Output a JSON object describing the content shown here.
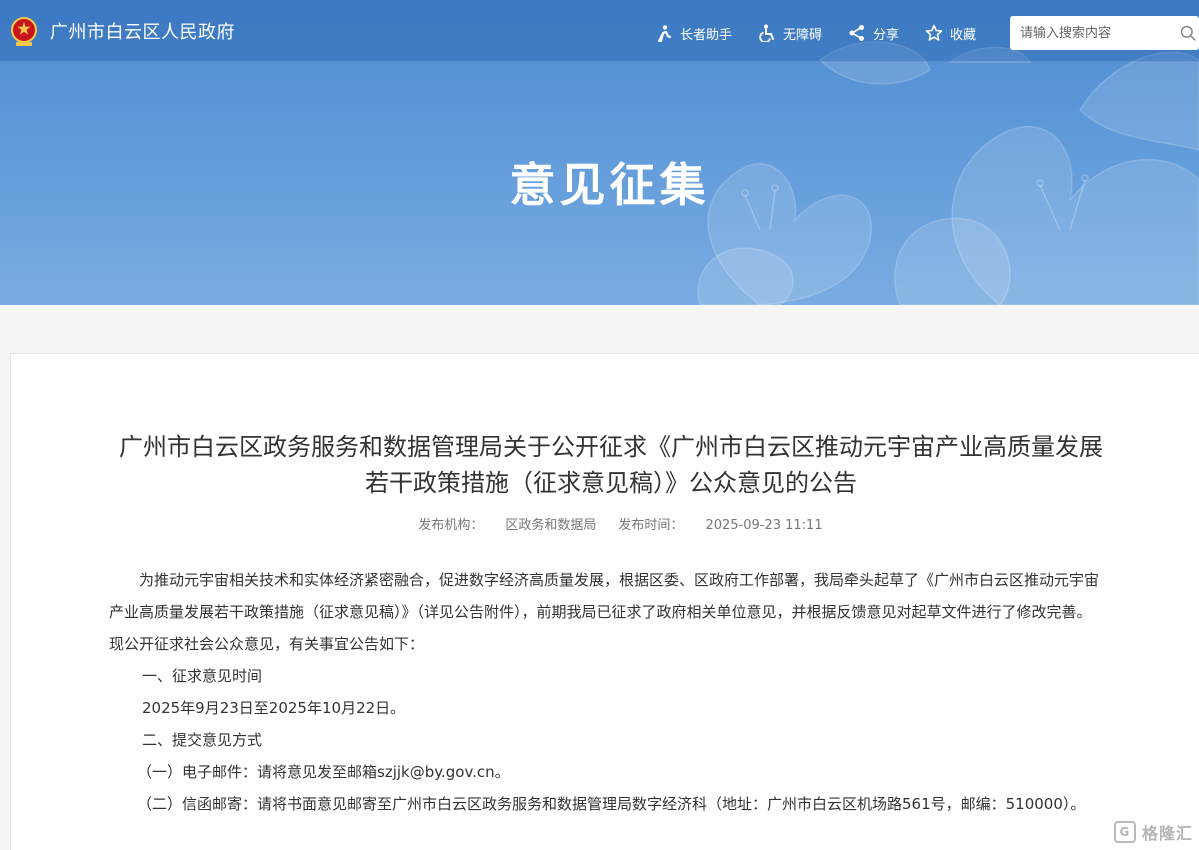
{
  "header": {
    "site_title": "广州市白云区人民政府",
    "tools": [
      {
        "label": "长者助手",
        "icon": "elder-assist-icon"
      },
      {
        "label": "无障碍",
        "icon": "accessibility-icon"
      },
      {
        "label": "分享",
        "icon": "share-icon"
      },
      {
        "label": "收藏",
        "icon": "star-icon"
      }
    ],
    "search": {
      "placeholder": "请输入搜索内容"
    }
  },
  "banner": {
    "title": "意见征集"
  },
  "article": {
    "title_line1": "广州市白云区政务服务和数据管理局关于公开征求《广州市白云区推动元宇宙产业高质量发展",
    "title_line2": "若干政策措施（征求意见稿）》公众意见的公告",
    "publisher_label": "发布机构：",
    "publisher": "区政务和数据局",
    "time_label": "发布时间：",
    "time": "2025-09-23 11:11",
    "paragraphs": [
      "为推动元宇宙相关技术和实体经济紧密融合，促进数字经济高质量发展，根据区委、区政府工作部署，我局牵头起草了《广州市白云区推动元宇宙产业高质量发展若干政策措施（征求意见稿）》（详见公告附件），前期我局已征求了政府相关单位意见，并根据反馈意见对起草文件进行了修改完善。现公开征求社会公众意见，有关事宜公告如下：",
      "一、征求意见时间",
      "2025年9月23日至2025年10月22日。",
      "二、提交意见方式",
      "（一）电子邮件：请将意见发至邮箱szjjk@by.gov.cn。",
      "（二）信函邮寄：请将书面意见邮寄至广州市白云区政务服务和数据管理局数字经济科（地址：广州市白云区机场路561号，邮编：510000）。"
    ]
  },
  "watermark": {
    "text": "格隆汇"
  },
  "colors": {
    "banner_top": "#4d8bd0",
    "banner_bottom": "#79ace2",
    "text": "#333333",
    "meta": "#777777"
  }
}
